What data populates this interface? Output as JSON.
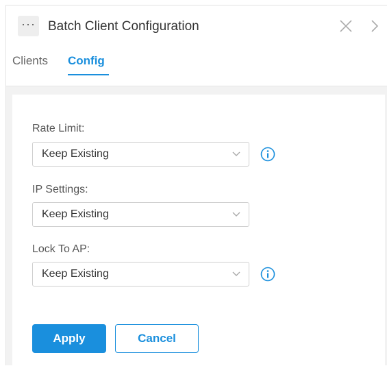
{
  "header": {
    "more_label": "···",
    "title": "Batch Client Configuration",
    "close_icon": "close-icon",
    "next_icon": "chevron-right-icon"
  },
  "tabs": [
    {
      "label": "Clients",
      "active": false
    },
    {
      "label": "Config",
      "active": true
    }
  ],
  "form": {
    "rate_limit": {
      "label": "Rate Limit:",
      "value": "Keep Existing",
      "info_icon": "info-icon"
    },
    "ip_settings": {
      "label": "IP Settings:",
      "value": "Keep Existing"
    },
    "lock_to_ap": {
      "label": "Lock To AP:",
      "value": "Keep Existing",
      "info_icon": "info-icon"
    }
  },
  "actions": {
    "apply_label": "Apply",
    "cancel_label": "Cancel"
  },
  "colors": {
    "accent": "#1a8fdd",
    "panel_bg": "#f2f2f2"
  }
}
